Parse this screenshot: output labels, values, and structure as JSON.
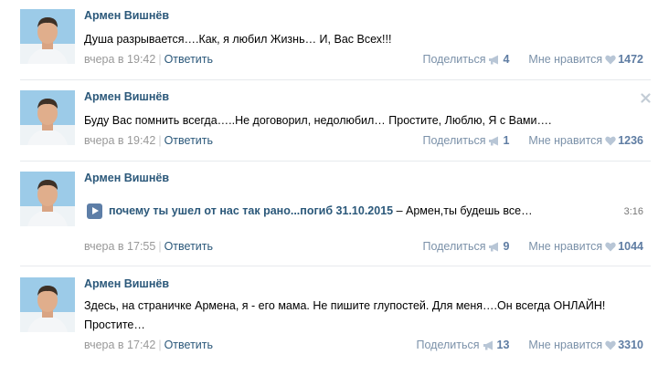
{
  "colors": {
    "author": "#2b587a",
    "meta": "#999999",
    "stats": "#7b91a9",
    "play": "#5d7ea7"
  },
  "icons": {
    "share": "megaphone-icon",
    "like": "heart-icon",
    "close": "close-icon"
  },
  "posts": [
    {
      "author": "Армен Вишнёв",
      "text": "Душа разрывается….Как, я любил Жизнь… И, Вас Всех!!!",
      "time": "вчера в 19:42",
      "reply": "Ответить",
      "share_label": "Поделиться",
      "share_count": "4",
      "like_label": "Мне нравится",
      "like_count": "1472"
    },
    {
      "author": "Армен Вишнёв",
      "text": "Буду Вас помнить всегда…..Не договорил, недолюбил… Простите, Люблю, Я с Вами….",
      "time": "вчера в 19:42",
      "reply": "Ответить",
      "share_label": "Поделиться",
      "share_count": "1",
      "like_label": "Мне нравится",
      "like_count": "1236"
    },
    {
      "author": "Армен Вишнёв",
      "audio": {
        "artist": "почему ты ушел от нас так рано...погиб 31.10.2015",
        "title": " – Армен,ты будешь все…",
        "duration": "3:16"
      },
      "time": "вчера в 17:55",
      "reply": "Ответить",
      "share_label": "Поделиться",
      "share_count": "9",
      "like_label": "Мне нравится",
      "like_count": "1044"
    },
    {
      "author": "Армен Вишнёв",
      "text_line1": "Здесь, на страничке Армена, я - его мама. Не пишите глупостей. Для меня….Он всегда ОНЛАЙН!",
      "text_line2": "Простите…",
      "time": "вчера в 17:42",
      "reply": "Ответить",
      "share_label": "Поделиться",
      "share_count": "13",
      "like_label": "Мне нравится",
      "like_count": "3310"
    }
  ]
}
